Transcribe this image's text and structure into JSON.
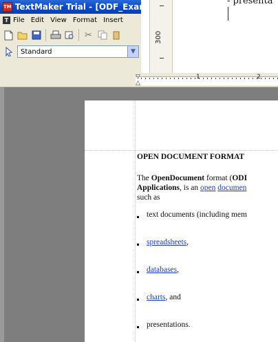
{
  "window": {
    "title": "TextMaker Trial - [ODF_Exam",
    "app_logo": "TM",
    "menu": [
      "File",
      "Edit",
      "View",
      "Format",
      "Insert"
    ],
    "toolbar_icons": [
      "new-document-icon",
      "open-folder-icon",
      "save-icon",
      "print-icon",
      "print-preview-icon",
      "cut-icon",
      "copy-icon",
      "paste-icon"
    ],
    "style_label": "Standard"
  },
  "background_doc": {
    "ruler_number": "300",
    "visible_text": "- presenta"
  },
  "ruler": {
    "number_1": "1",
    "number_2": "2"
  },
  "document": {
    "heading": "OPEN DOCUMENT FORMAT",
    "para": {
      "the": "The ",
      "opendocument": "OpenDocument",
      "format": " format (",
      "odf": "ODI",
      "applications": "Applications",
      "is_an": ", is an ",
      "open": "open",
      "document": "documen",
      "such_as": "such as"
    },
    "bullets": [
      {
        "text": "text documents (including mem",
        "link": false
      },
      {
        "text": "spreadsheets",
        "suffix": ",",
        "link": true
      },
      {
        "text": "databases",
        "suffix": ",",
        "link": true
      },
      {
        "text": "charts",
        "suffix": ", and",
        "link": true
      },
      {
        "text": "presentations.",
        "link": false
      }
    ]
  },
  "colors": {
    "titlebar": "#0a48c4",
    "link": "#1a3ccf",
    "workspace": "#7e7e7e"
  }
}
